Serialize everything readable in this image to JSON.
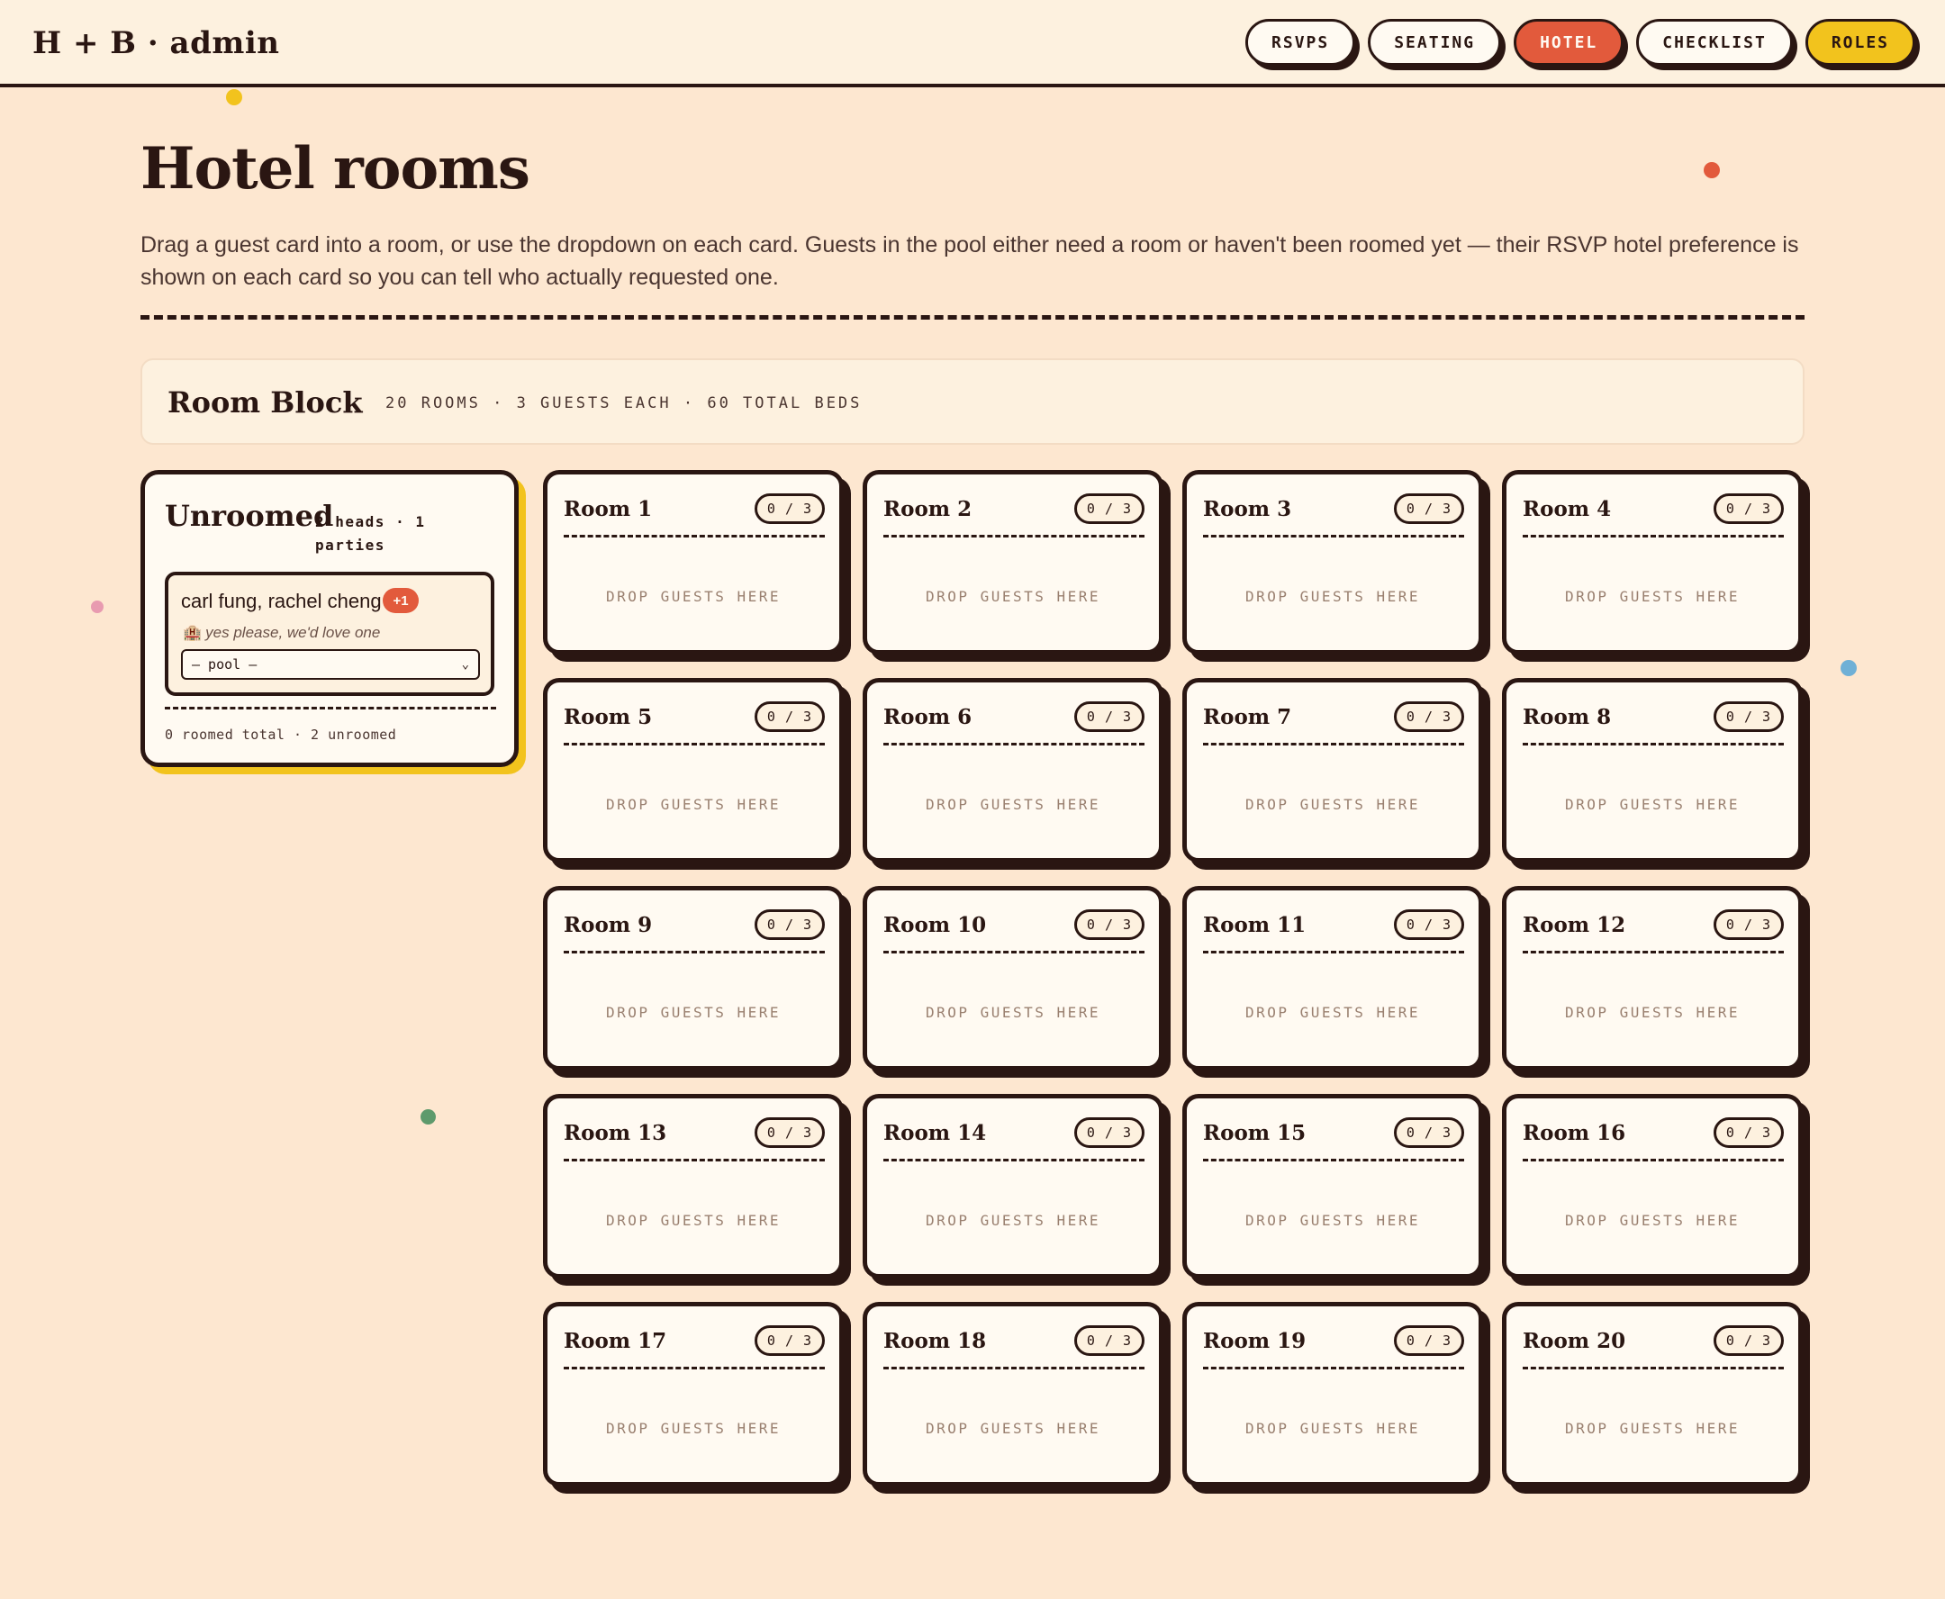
{
  "brand": "H + B · admin",
  "nav": [
    {
      "label": "RSVPS",
      "name": "nav-rsvps",
      "variant": ""
    },
    {
      "label": "SEATING",
      "name": "nav-seating",
      "variant": ""
    },
    {
      "label": "HOTEL",
      "name": "nav-hotel",
      "variant": "active"
    },
    {
      "label": "CHECKLIST",
      "name": "nav-checklist",
      "variant": ""
    },
    {
      "label": "ROLES",
      "name": "nav-roles",
      "variant": "roles"
    }
  ],
  "page": {
    "title": "Hotel rooms",
    "description": "Drag a guest card into a room, or use the dropdown on each card. Guests in the pool either need a room or haven't been roomed yet — their RSVP hotel preference is shown on each card so you can tell who actually requested one."
  },
  "room_block": {
    "title": "Room Block",
    "meta": "20 ROOMS · 3 GUESTS EACH · 60 TOTAL BEDS"
  },
  "unroomed": {
    "title": "Unroomed",
    "count": "2 heads · 1 parties",
    "guests": [
      {
        "name": "carl fung, rachel cheng",
        "badge": "+1",
        "preference_icon": "hotel-icon",
        "preference": "yes please, we'd love one",
        "select_value": "— pool —"
      }
    ],
    "footer": "0 roomed total · 2 unroomed"
  },
  "rooms": [
    {
      "name": "Room 1",
      "capacity": "0 / 3",
      "empty_label": "DROP GUESTS HERE"
    },
    {
      "name": "Room 2",
      "capacity": "0 / 3",
      "empty_label": "DROP GUESTS HERE"
    },
    {
      "name": "Room 3",
      "capacity": "0 / 3",
      "empty_label": "DROP GUESTS HERE"
    },
    {
      "name": "Room 4",
      "capacity": "0 / 3",
      "empty_label": "DROP GUESTS HERE"
    },
    {
      "name": "Room 5",
      "capacity": "0 / 3",
      "empty_label": "DROP GUESTS HERE"
    },
    {
      "name": "Room 6",
      "capacity": "0 / 3",
      "empty_label": "DROP GUESTS HERE"
    },
    {
      "name": "Room 7",
      "capacity": "0 / 3",
      "empty_label": "DROP GUESTS HERE"
    },
    {
      "name": "Room 8",
      "capacity": "0 / 3",
      "empty_label": "DROP GUESTS HERE"
    },
    {
      "name": "Room 9",
      "capacity": "0 / 3",
      "empty_label": "DROP GUESTS HERE"
    },
    {
      "name": "Room 10",
      "capacity": "0 / 3",
      "empty_label": "DROP GUESTS HERE"
    },
    {
      "name": "Room 11",
      "capacity": "0 / 3",
      "empty_label": "DROP GUESTS HERE"
    },
    {
      "name": "Room 12",
      "capacity": "0 / 3",
      "empty_label": "DROP GUESTS HERE"
    },
    {
      "name": "Room 13",
      "capacity": "0 / 3",
      "empty_label": "DROP GUESTS HERE"
    },
    {
      "name": "Room 14",
      "capacity": "0 / 3",
      "empty_label": "DROP GUESTS HERE"
    },
    {
      "name": "Room 15",
      "capacity": "0 / 3",
      "empty_label": "DROP GUESTS HERE"
    },
    {
      "name": "Room 16",
      "capacity": "0 / 3",
      "empty_label": "DROP GUESTS HERE"
    },
    {
      "name": "Room 17",
      "capacity": "0 / 3",
      "empty_label": "DROP GUESTS HERE"
    },
    {
      "name": "Room 18",
      "capacity": "0 / 3",
      "empty_label": "DROP GUESTS HERE"
    },
    {
      "name": "Room 19",
      "capacity": "0 / 3",
      "empty_label": "DROP GUESTS HERE"
    },
    {
      "name": "Room 20",
      "capacity": "0 / 3",
      "empty_label": "DROP GUESTS HERE"
    }
  ],
  "colors": {
    "background": "#fde7d0",
    "ink": "#2a1612",
    "accent_red": "#e25a3c",
    "accent_yellow": "#f2c31d",
    "card": "#fffaf2",
    "dot_pink": "#e89bb0",
    "dot_blue": "#6fb0d6",
    "dot_green": "#5e9a6c"
  }
}
